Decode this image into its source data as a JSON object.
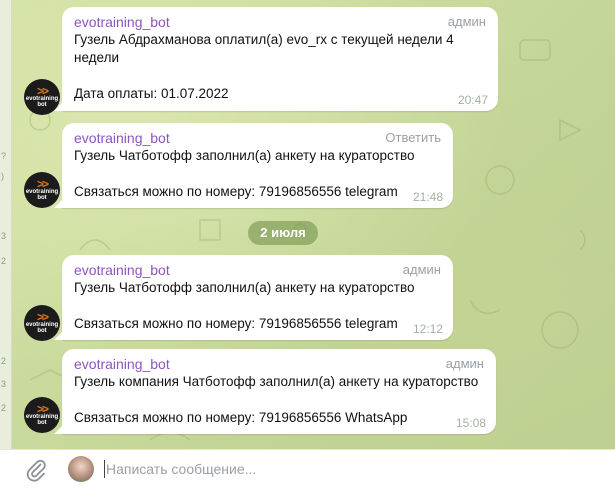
{
  "messages": [
    {
      "sender": "evotraining_bot",
      "role": "админ",
      "text": "Гузель Абдрахманова оплатил(а) evo_rx с текущей недели 4\nнедели\n\nДата оплаты: 01.07.2022",
      "time": "20:47"
    },
    {
      "sender": "evotraining_bot",
      "role": "Ответить",
      "text": "Гузель Чатботофф заполнил(а) анкету на кураторство\n\nСвязаться можно по номеру: 79196856556 telegram",
      "time": "21:48"
    },
    {
      "sender": "evotraining_bot",
      "role": "админ",
      "text": "Гузель Чатботофф заполнил(а) анкету на кураторство\n\nСвязаться можно по номеру: 79196856556 telegram",
      "time": "12:12"
    },
    {
      "sender": "evotraining_bot",
      "role": "админ",
      "text": "Гузель компания Чатботофф заполнил(а) анкету на кураторство\n\nСвязаться можно по номеру: 79196856556 WhatsApp",
      "time": "15:08"
    }
  ],
  "date_divider": "2 июля",
  "avatar": {
    "label": "evotraining\nbot",
    "chevrons": ">>",
    "bg": "#1b1b1b",
    "accent": "#e0771f"
  },
  "composer": {
    "placeholder": "Написать сообщение...",
    "attach_icon": "paperclip-icon"
  },
  "left_strip_marks": [
    "?",
    ")",
    "3",
    "2",
    "2",
    "3",
    "2"
  ],
  "colors": {
    "sender": "#8e55bd",
    "bubble": "#ffffff",
    "chat_bg": "#cfdca4"
  }
}
